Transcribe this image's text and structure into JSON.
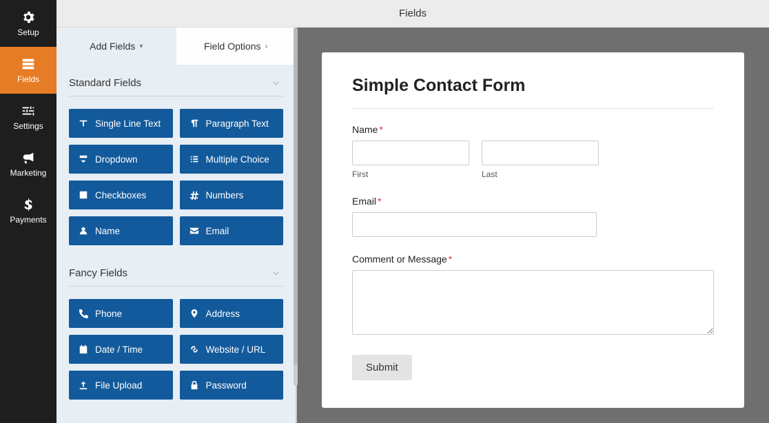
{
  "topbar": {
    "title": "Fields"
  },
  "sidebar": {
    "items": [
      {
        "label": "Setup"
      },
      {
        "label": "Fields"
      },
      {
        "label": "Settings"
      },
      {
        "label": "Marketing"
      },
      {
        "label": "Payments"
      }
    ]
  },
  "panel": {
    "tabs": {
      "add": "Add Fields",
      "options": "Field Options"
    },
    "groups": {
      "standard": {
        "title": "Standard Fields",
        "items": [
          {
            "label": "Single Line Text"
          },
          {
            "label": "Paragraph Text"
          },
          {
            "label": "Dropdown"
          },
          {
            "label": "Multiple Choice"
          },
          {
            "label": "Checkboxes"
          },
          {
            "label": "Numbers"
          },
          {
            "label": "Name"
          },
          {
            "label": "Email"
          }
        ]
      },
      "fancy": {
        "title": "Fancy Fields",
        "items": [
          {
            "label": "Phone"
          },
          {
            "label": "Address"
          },
          {
            "label": "Date / Time"
          },
          {
            "label": "Website / URL"
          },
          {
            "label": "File Upload"
          },
          {
            "label": "Password"
          }
        ]
      }
    }
  },
  "form": {
    "title": "Simple Contact Form",
    "name_label": "Name",
    "first_sub": "First",
    "last_sub": "Last",
    "email_label": "Email",
    "message_label": "Comment or Message",
    "submit": "Submit"
  }
}
